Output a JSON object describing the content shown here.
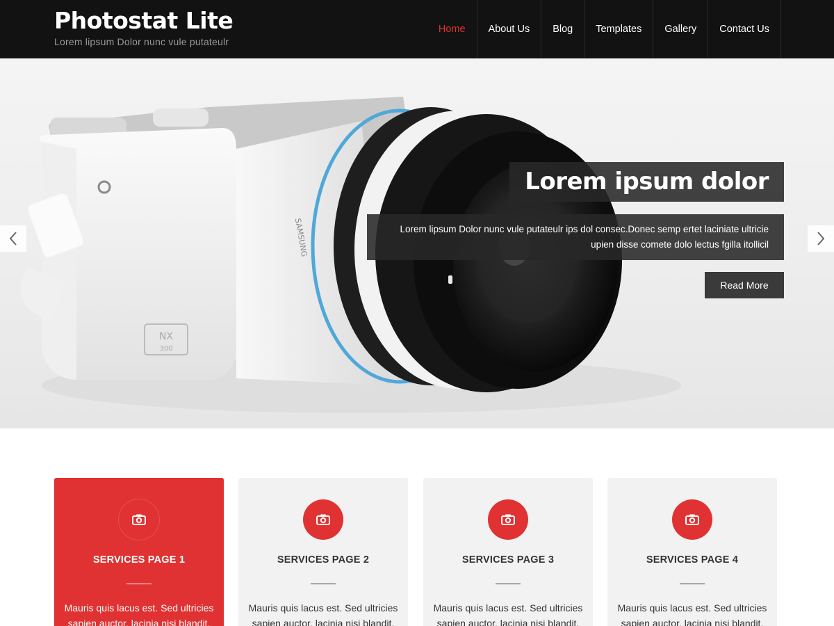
{
  "header": {
    "site_title": "Photostat Lite",
    "tagline": "Lorem lipsum Dolor nunc vule putateulr"
  },
  "nav": {
    "items": [
      {
        "label": "Home",
        "active": true
      },
      {
        "label": "About Us",
        "active": false
      },
      {
        "label": "Blog",
        "active": false
      },
      {
        "label": "Templates",
        "active": false
      },
      {
        "label": "Gallery",
        "active": false
      },
      {
        "label": "Contact Us",
        "active": false
      }
    ]
  },
  "hero": {
    "title": "Lorem ipsum dolor",
    "text": "Lorem lipsum Dolor nunc vule putateulr ips dol consec.Donec semp ertet laciniate ultricie upien disse comete dolo lectus fgilla itollicil",
    "button_label": "Read More",
    "prev_icon": "chevron-left-icon",
    "next_icon": "chevron-right-icon",
    "image_subject": "camera",
    "camera_brand": "SAMSUNG",
    "camera_model": "NX",
    "camera_model_number": "300"
  },
  "services": {
    "icon": "camera-icon",
    "items": [
      {
        "title": "SERVICES PAGE 1",
        "text": "Mauris quis lacus est. Sed ultricies sapien auctor, lacinia nisi blandit.",
        "featured": true
      },
      {
        "title": "SERVICES PAGE 2",
        "text": "Mauris quis lacus est. Sed ultricies sapien auctor, lacinia nisi blandit.",
        "featured": false
      },
      {
        "title": "SERVICES PAGE 3",
        "text": "Mauris quis lacus est. Sed ultricies sapien auctor, lacinia nisi blandit.",
        "featured": false
      },
      {
        "title": "SERVICES PAGE 4",
        "text": "Mauris quis lacus est. Sed ultricies sapien auctor, lacinia nisi blandit.",
        "featured": false
      }
    ]
  },
  "colors": {
    "accent": "#e03232",
    "header_bg": "#121212",
    "card_bg": "#f2f2f2"
  }
}
